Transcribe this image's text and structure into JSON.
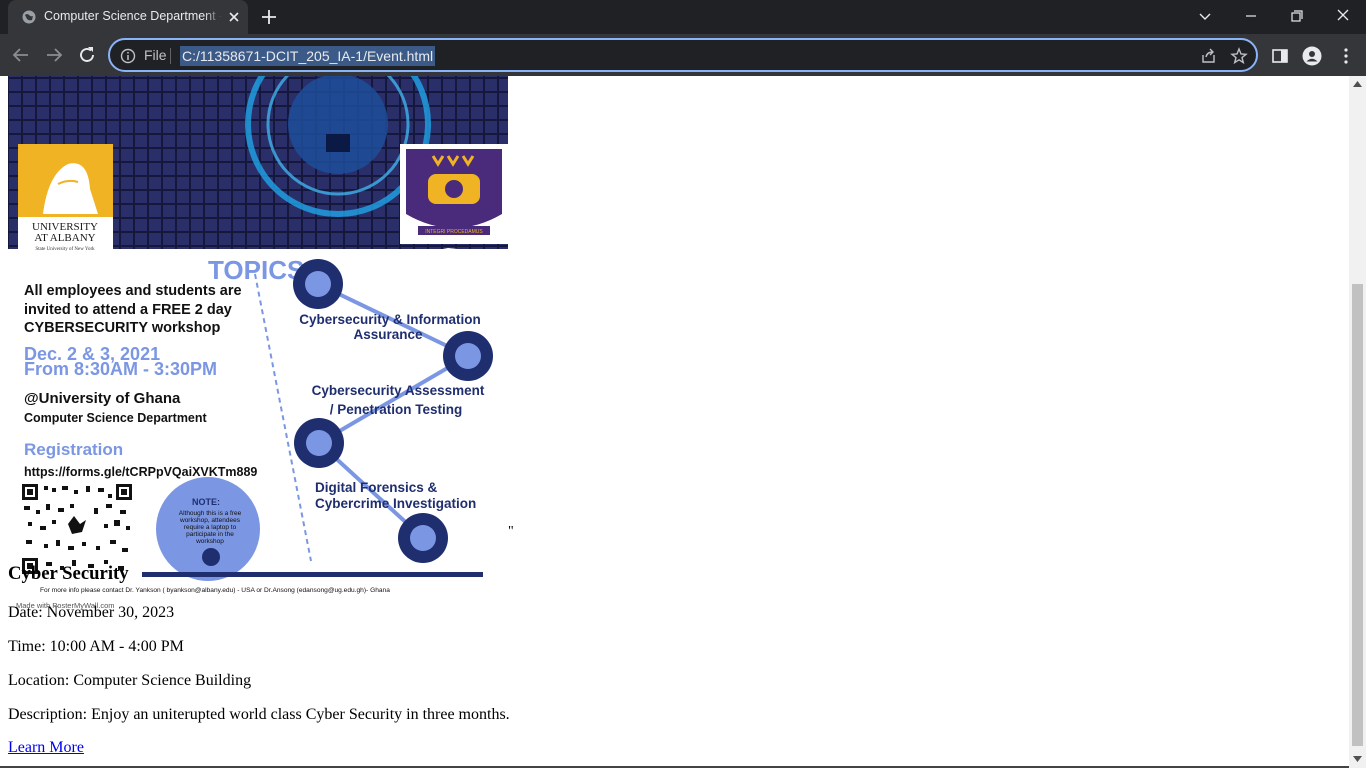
{
  "browser": {
    "tab": {
      "title": "Computer Science Department - Event"
    },
    "address": {
      "scheme_label": "File",
      "url": "C:/11358671-DCIT_205_IA-1/Event.html"
    },
    "colors": {
      "chrome_dark": "#202124",
      "chrome_mid": "#35363a",
      "focus_ring": "#8ab4f8"
    }
  },
  "poster": {
    "logo_left": {
      "line1": "UNIVERSITY",
      "line2": "AT ALBANY",
      "line3": "State University of New York"
    },
    "logo_right_motto": "INTEGRI PROCEDAMUS",
    "topics_heading": "TOPICS",
    "intro_lines": [
      "All employees and students are",
      "invited to attend a FREE 2 day",
      "CYBERSECURITY workshop"
    ],
    "dates": "Dec. 2 & 3, 2021",
    "times": "From 8:30AM - 3:30PM",
    "venue": "@University of Ghana",
    "venue_dept": "Computer Science Department",
    "registration_label": "Registration",
    "registration_url": "https://forms.gle/tCRPpVQaiXVKTm889",
    "topics": [
      {
        "line1": "Cybersecurity & Information",
        "line2": "Assurance"
      },
      {
        "line1": "Cybersecurity Assessment",
        "line2": "/ Penetration Testing"
      },
      {
        "line1": "Digital Forensics &",
        "line2": "Cybercrime Investigation"
      }
    ],
    "note_title": "NOTE:",
    "note_lines": [
      "Although this is a free",
      "workshop, attendees",
      "require a laptop to",
      "participate in the",
      "workshop"
    ],
    "footer_contact": "For more info please contact Dr. Yankson ( byankson@albany.edu) - USA   or Dr.Ansong (edansong@ug.edu.gh)- Ghana",
    "made_with": "Made with PosterMyWall.com",
    "colors": {
      "navy": "#1f2e6e",
      "periwinkle": "#7b96e3",
      "gold": "#f0b323"
    }
  },
  "stray_text": "\"",
  "event": {
    "title": "Cyber Security",
    "date": "Date: November 30, 2023",
    "time": "Time: 10:00 AM - 4:00 PM",
    "location": "Location: Computer Science Building",
    "description": "Description: Enjoy an uniterupted world class Cyber Security in three months.",
    "link": "Learn More"
  }
}
